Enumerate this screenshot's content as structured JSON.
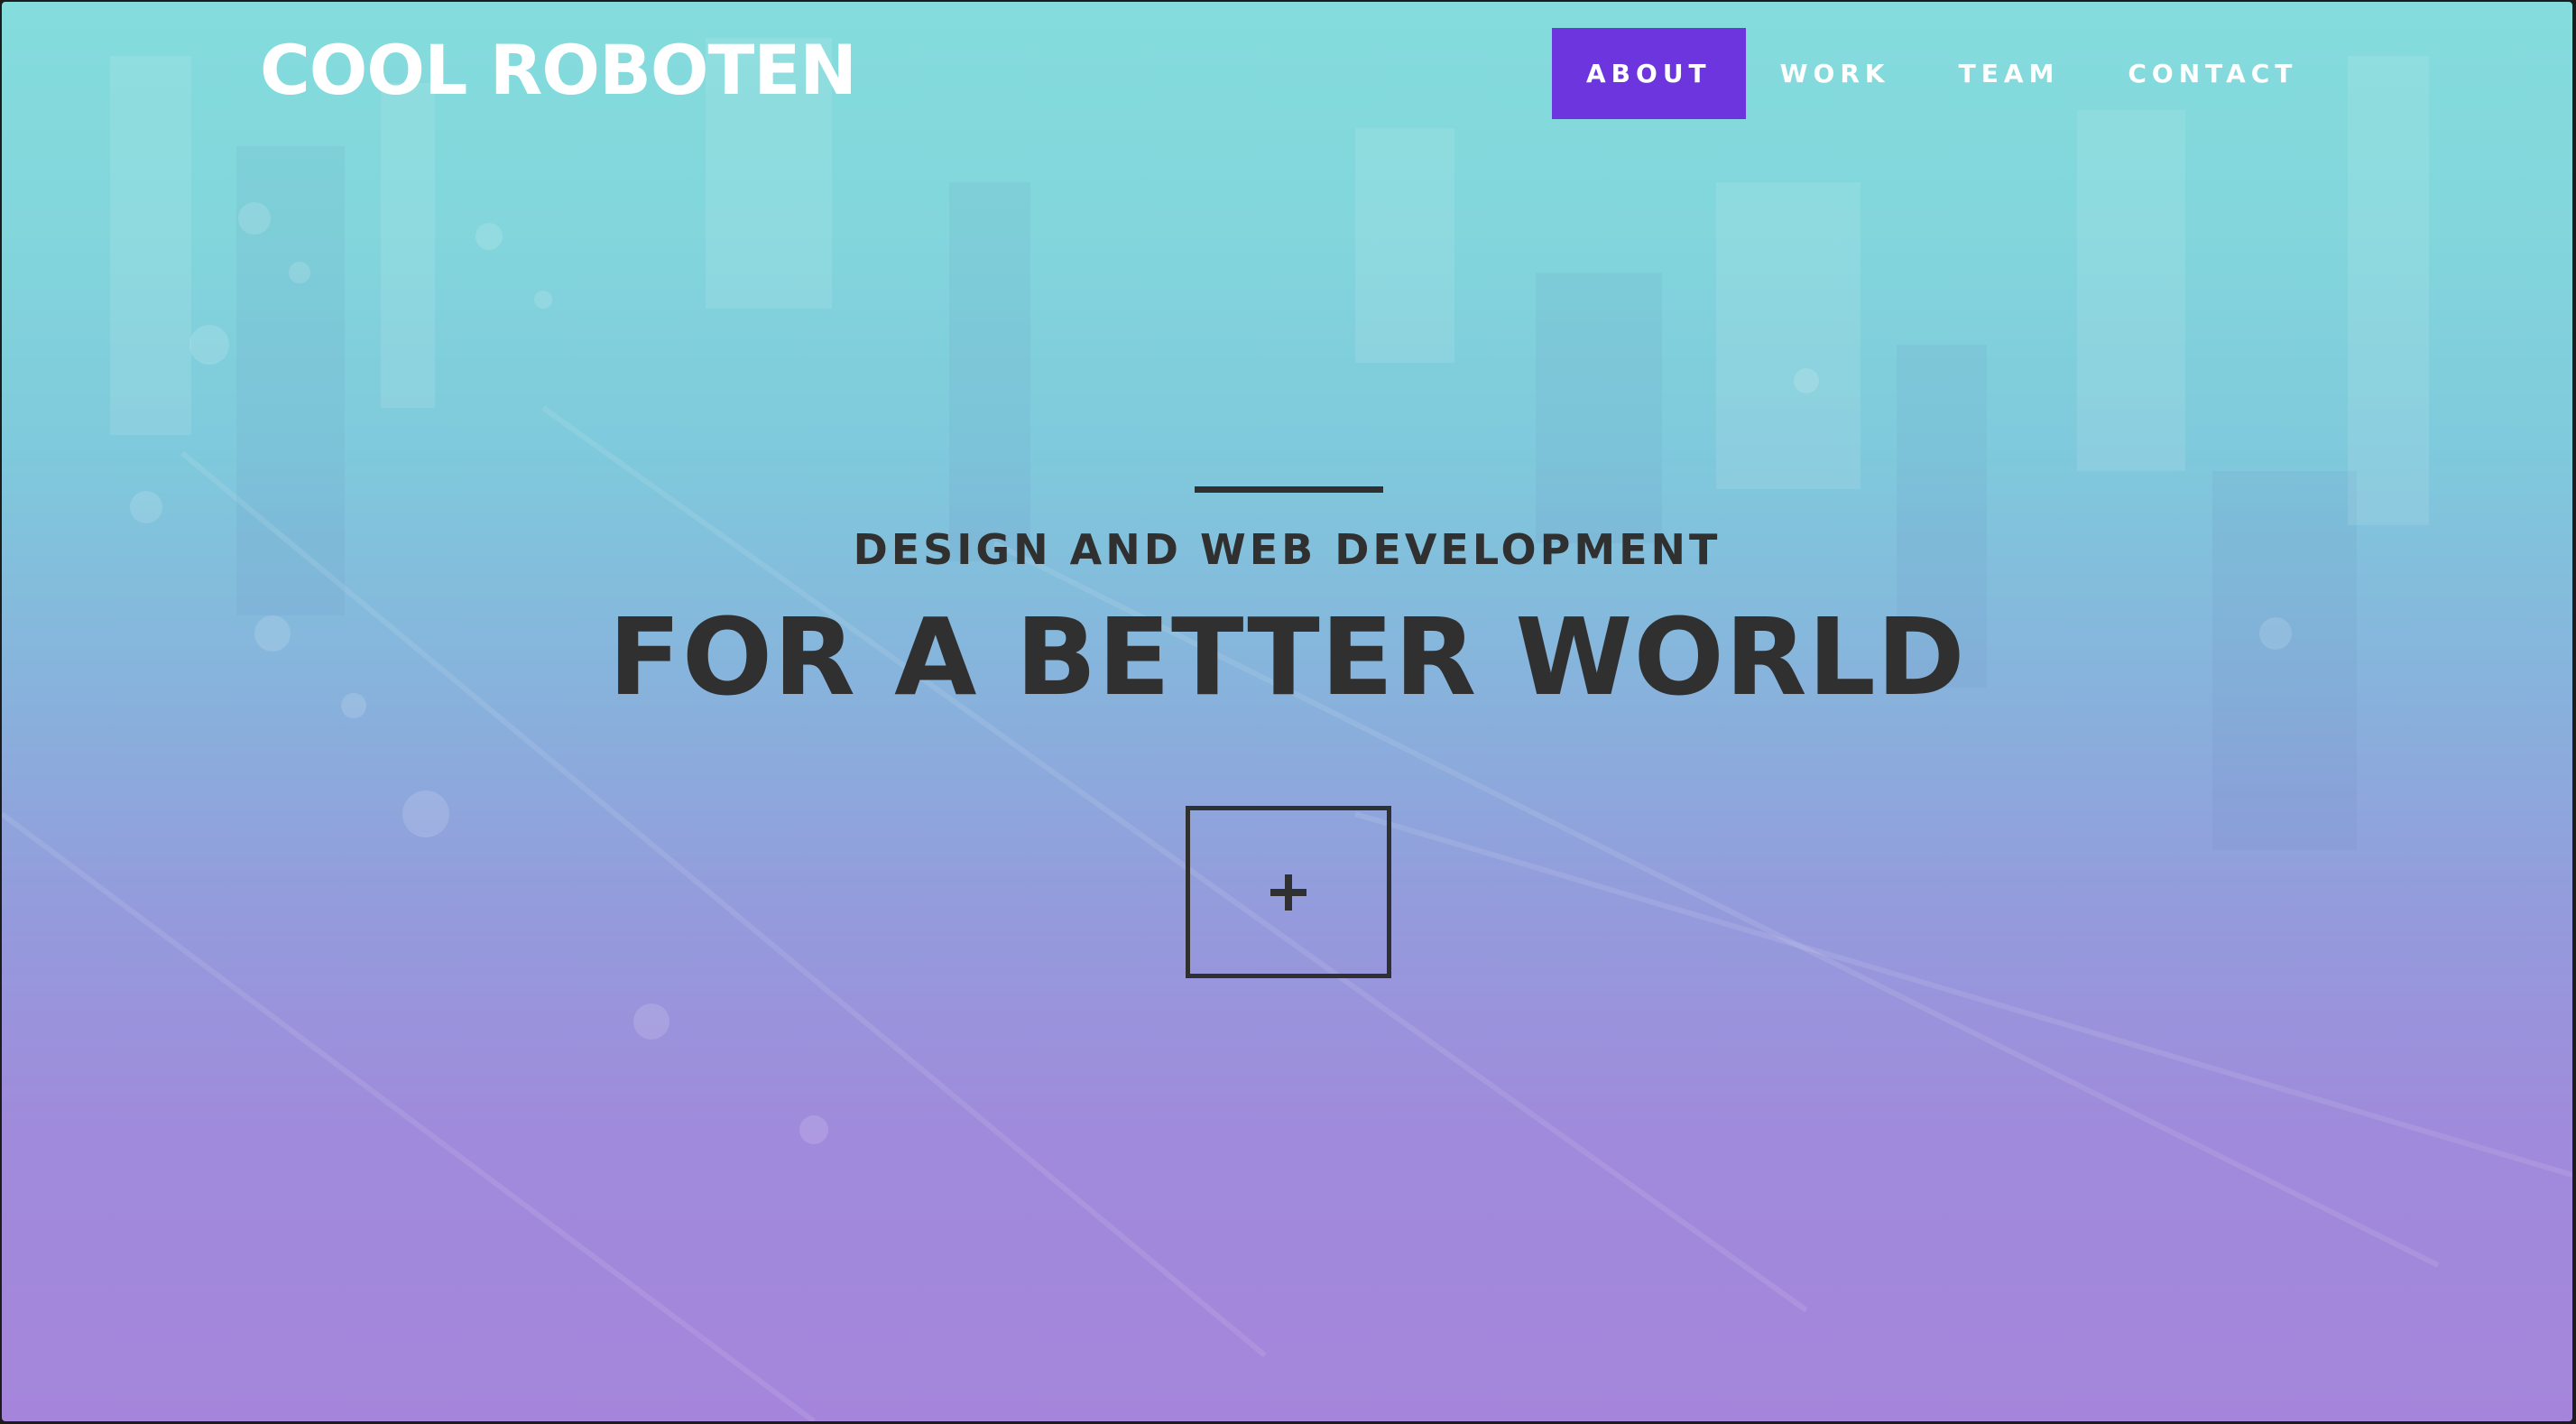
{
  "brand": {
    "name": "COOL ROBOTEN"
  },
  "nav": {
    "items": [
      {
        "label": "ABOUT",
        "active": true
      },
      {
        "label": "WORK",
        "active": false
      },
      {
        "label": "TEAM",
        "active": false
      },
      {
        "label": "CONTACT",
        "active": false
      }
    ]
  },
  "hero": {
    "subtitle": "DESIGN AND WEB DEVELOPMENT",
    "headline": "FOR A BETTER WORLD",
    "cta_icon": "plus-icon"
  },
  "colors": {
    "accent": "#6c35de",
    "text_dark": "#303030",
    "gradient_top": "#84dcdc",
    "gradient_bottom": "#a585db"
  }
}
